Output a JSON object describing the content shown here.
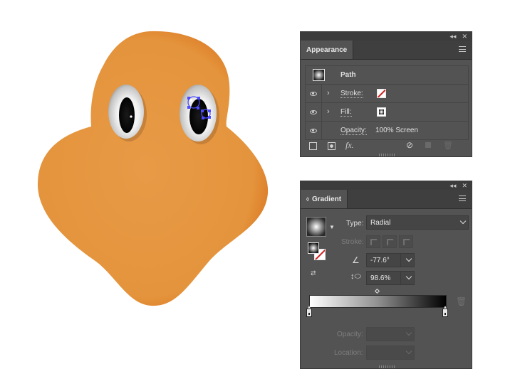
{
  "appearance_panel": {
    "tab": "Appearance",
    "rows": [
      {
        "label": "Path"
      },
      {
        "label": "Stroke:"
      },
      {
        "label": "Fill:"
      },
      {
        "label": "Opacity:",
        "value": "100% Screen"
      }
    ],
    "footer_icons": [
      "add-stroke-icon",
      "add-fill-icon",
      "fx-icon",
      "clear-icon",
      "duplicate-icon",
      "delete-icon"
    ],
    "fx_label": "fx."
  },
  "gradient_panel": {
    "tab": "Gradient",
    "type_label": "Type:",
    "type_value": "Radial",
    "stroke_label": "Stroke:",
    "angle_value": "-77.6°",
    "aspect_value": "98.6%",
    "opacity_label": "Opacity:",
    "location_label": "Location:",
    "gradient_stops": [
      {
        "color": "#ffffff",
        "location": 0
      },
      {
        "color": "#000000",
        "location": 100
      }
    ]
  },
  "colors": {
    "panel_bg": "#535353",
    "character_orange": "#e5953f",
    "character_outline": "#d4661c",
    "stroke_none_red": "#d01c1c"
  }
}
